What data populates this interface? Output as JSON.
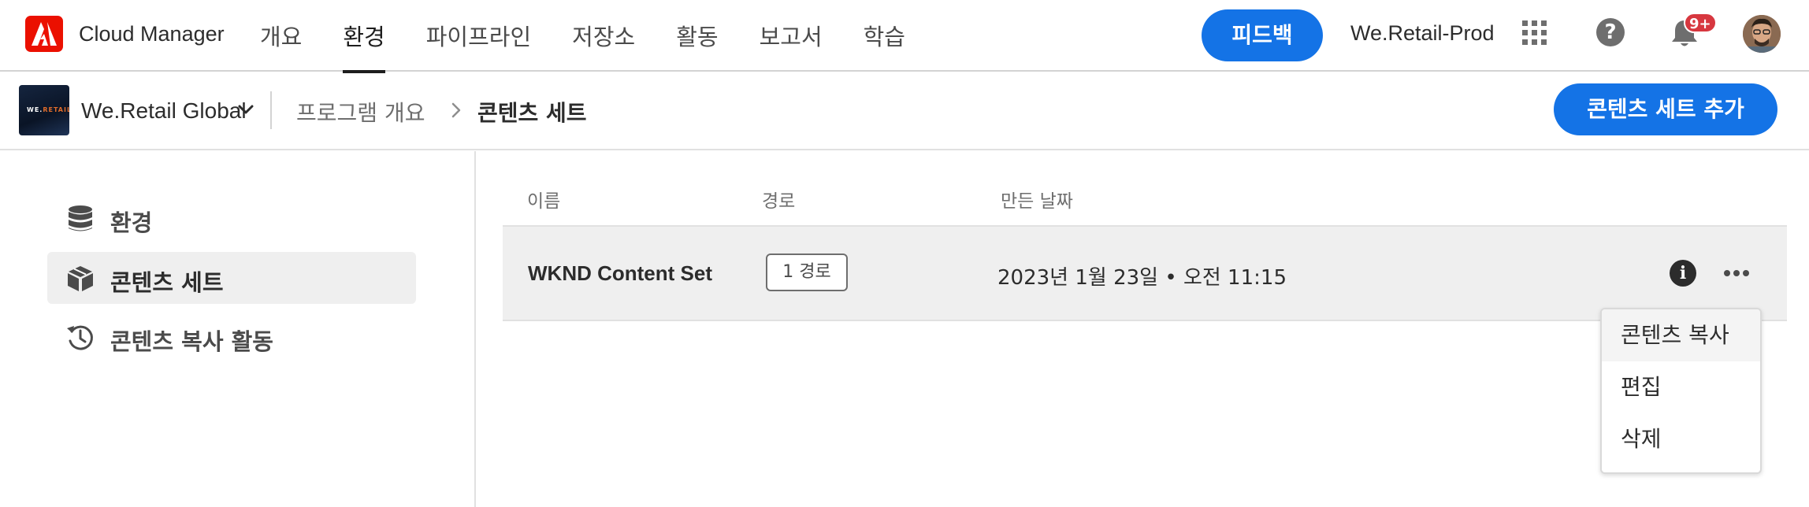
{
  "app": {
    "name": "Cloud Manager"
  },
  "nav": {
    "tabs": [
      {
        "label": "개요"
      },
      {
        "label": "환경",
        "active": true
      },
      {
        "label": "파이프라인"
      },
      {
        "label": "저장소"
      },
      {
        "label": "활동"
      },
      {
        "label": "보고서"
      },
      {
        "label": "학습"
      }
    ],
    "feedback_label": "피드백",
    "org_name": "We.Retail-Prod",
    "notification_badge": "9+",
    "help_glyph": "?"
  },
  "program": {
    "name": "We.Retail Global",
    "thumb_text_a": "WE.",
    "thumb_text_b": "RETAIL"
  },
  "breadcrumb": {
    "parent": "프로그램 개요",
    "current": "콘텐츠 세트"
  },
  "actions": {
    "add_content_set": "콘텐츠 세트 추가"
  },
  "sidebar": {
    "items": [
      {
        "label": "환경",
        "icon": "database-icon"
      },
      {
        "label": "콘텐츠 세트",
        "icon": "box-icon",
        "active": true
      },
      {
        "label": "콘텐츠 복사 활동",
        "icon": "history-icon"
      }
    ]
  },
  "table": {
    "columns": [
      "이름",
      "경로",
      "만든 날짜"
    ],
    "rows": [
      {
        "name": "WKND Content Set",
        "paths": "1 경로",
        "created": "2023년 1월 23일 • 오전 11:15"
      }
    ],
    "info_glyph": "i"
  },
  "row_menu": {
    "items": [
      "콘텐츠 복사",
      "편집",
      "삭제"
    ]
  },
  "colors": {
    "accent": "#1473e6",
    "brand": "#eb1000",
    "badge": "#d7373f"
  }
}
